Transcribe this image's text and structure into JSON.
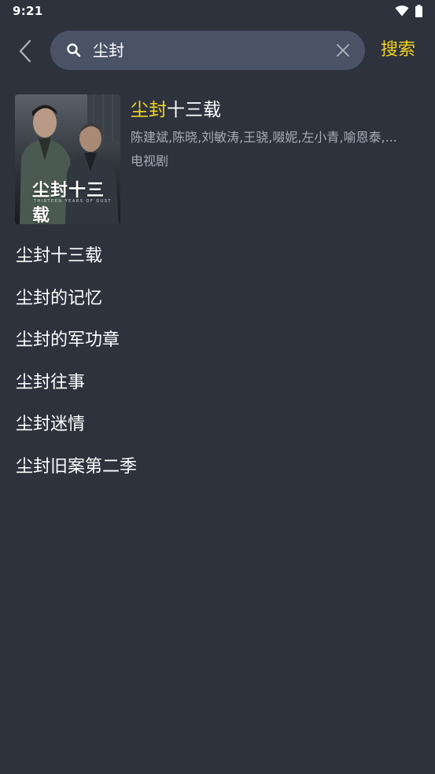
{
  "status_bar": {
    "time": "9:21"
  },
  "header": {
    "search_value": "尘封",
    "submit_label": "搜索"
  },
  "result": {
    "title_highlight": "尘封",
    "title_rest": "十三载",
    "cast": "陈建斌,陈晓,刘敏涛,王骁,啜妮,左小青,喻恩泰,...",
    "type": "电视剧",
    "poster_title": "尘封十三载",
    "poster_subtitle": "THIRTEEN YEARS OF DUST"
  },
  "suggestions": [
    "尘封十三载",
    "尘封的记忆",
    "尘封的军功章",
    "尘封往事",
    "尘封迷情",
    "尘封旧案第二季"
  ],
  "colors": {
    "background": "#2e323d",
    "search_box": "#4a5365",
    "accent": "#f2d522",
    "secondary_text": "#a6acb8"
  }
}
